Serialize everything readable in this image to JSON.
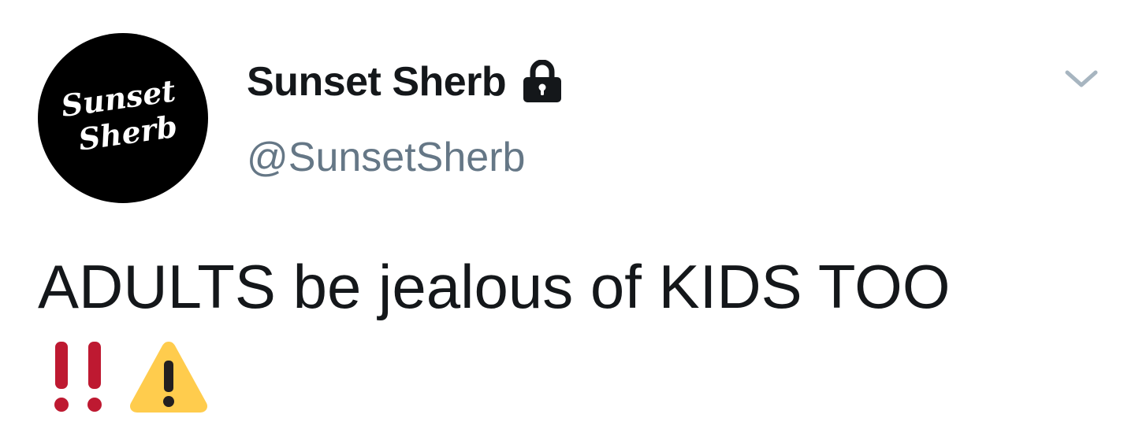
{
  "tweet": {
    "avatar": {
      "line1": "Sunset",
      "line2": "Sherb"
    },
    "display_name": "Sunset Sherb",
    "protected_icon": "lock-icon",
    "handle": "@SunsetSherb",
    "menu_icon": "chevron-down-icon",
    "text": "ADULTS be jealous of KIDS TOO",
    "emojis": [
      "double-exclamation-icon",
      "warning-icon"
    ]
  },
  "colors": {
    "name": "#14171a",
    "handle": "#657786",
    "caret": "#a7b5c0",
    "avatar_bg": "#000000",
    "bangbang": "#be1931",
    "warning": "#ffcc4d"
  }
}
